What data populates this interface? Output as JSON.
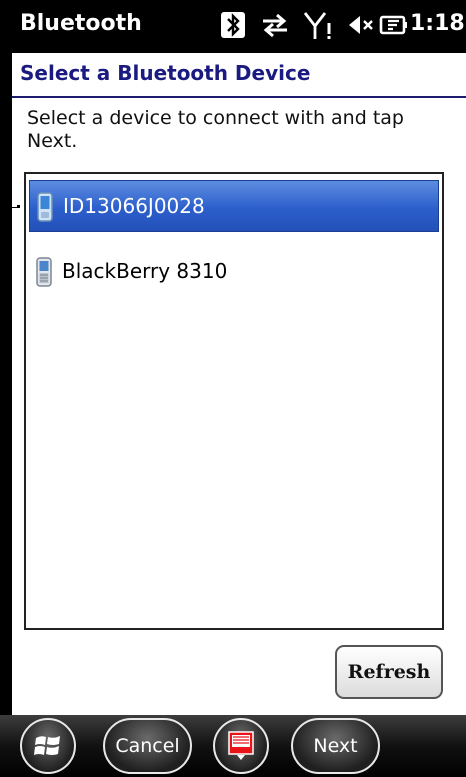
{
  "status_bar": {
    "app_title": "Bluetooth",
    "time": "1:18",
    "icons": [
      "bluetooth-icon",
      "data-sync-icon",
      "signal-icon",
      "volume-muted-icon",
      "battery-charging-icon"
    ]
  },
  "header": {
    "title": "Select a Bluetooth Device"
  },
  "instruction": "Select a device to connect with and tap Next.",
  "devices": [
    {
      "label": "ID13066J0028",
      "selected": true,
      "icon": "device-icon"
    },
    {
      "label": "BlackBerry 8310",
      "selected": false,
      "icon": "phone-icon"
    }
  ],
  "buttons": {
    "refresh": "Refresh",
    "cancel": "Cancel",
    "next": "Next"
  },
  "colors": {
    "header_text": "#1a1a80",
    "selection": "#2c5fcc",
    "bars": "#000000"
  }
}
